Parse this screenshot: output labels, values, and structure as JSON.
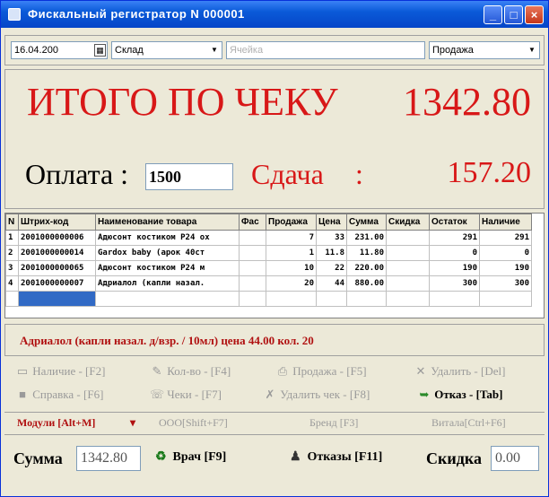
{
  "window": {
    "title": "Фискальный регистратор N 000001",
    "controls": {
      "minimize": "_",
      "maximize": "□",
      "close": "×"
    }
  },
  "toolbar": {
    "date": "16.04.200",
    "calendar_icon": "calendar-icon",
    "warehouse": "Склад",
    "field_placeholder": "Ячейка",
    "operation": "Продажа"
  },
  "totals": {
    "receipt_total_label": "ИТОГО ПО ЧЕКУ",
    "receipt_total_value": "1342.80",
    "payment_label": "Оплата :",
    "payment_value": "1500",
    "change_label": "Сдача",
    "change_colon": ":",
    "change_value": "157.20"
  },
  "table": {
    "columns": [
      "N",
      "Штрих-код",
      "Наименование товара",
      "Фас",
      "Продажа",
      "Цена",
      "Сумма",
      "Скидка",
      "Остаток",
      "Наличие"
    ],
    "rows": [
      [
        "1",
        "2001000000006",
        "Адюсонт костиком Р24 ох",
        "",
        "7",
        "33",
        "231.00",
        "",
        "291",
        "291"
      ],
      [
        "2",
        "2001000000014",
        "Gardox baby (арок 40ст",
        "",
        "1",
        "11.8",
        "11.80",
        "",
        "0",
        "0"
      ],
      [
        "3",
        "2001000000065",
        "Адюсонт костиком Р24 м",
        "",
        "10",
        "22",
        "220.00",
        "",
        "190",
        "190"
      ],
      [
        "4",
        "2001000000007",
        "Адриалол (капли назал.",
        "",
        "20",
        "44",
        "880.00",
        "",
        "300",
        "300"
      ]
    ]
  },
  "detail": {
    "text": "Адриалол (капли назал. д/взр. / 10мл)   цена 44.00 кол. 20"
  },
  "actions": [
    {
      "label": "Наличие - [F2]",
      "icon": "document-icon",
      "glyph": "▭",
      "enabled": false
    },
    {
      "label": "Кол-во - [F4]",
      "icon": "edit-icon",
      "glyph": "✎",
      "enabled": false
    },
    {
      "label": "Продажа - [F5]",
      "icon": "printer-icon",
      "glyph": "⎙",
      "enabled": false
    },
    {
      "label": "Удалить - [Del]",
      "icon": "cross-icon",
      "glyph": "✕",
      "enabled": false
    },
    {
      "label": "Справка - [F6]",
      "icon": "info-box-icon",
      "glyph": "■",
      "enabled": false
    },
    {
      "label": "Чеки - [F7]",
      "icon": "receipts-icon",
      "glyph": "☏",
      "enabled": false
    },
    {
      "label": "Удалить чек - [F8]",
      "icon": "delete-receipt-icon",
      "glyph": "✗",
      "enabled": false
    },
    {
      "label": "Отказ - [Tab]",
      "icon": "arrow-icon",
      "glyph": "➥",
      "enabled": true
    }
  ],
  "modules": {
    "modules_label": "Модули [Alt+M]",
    "ooo_label": "ООО[Shift+F7]",
    "brand_label": "Бренд [F3]",
    "showcase_label": "Витала[Ctrl+F6]"
  },
  "bottom": {
    "sum_label": "Сумма",
    "sum_value": "1342.80",
    "doctor_label": "Врач [F9]",
    "refusals_label": "Отказы [F11]",
    "discount_label": "Скидка",
    "discount_value": "0.00"
  }
}
